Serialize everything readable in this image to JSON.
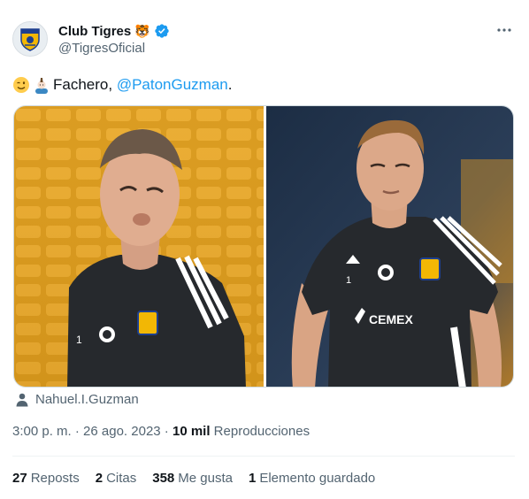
{
  "author": {
    "display_name": "Club Tigres",
    "name_badge_emoji": "🐯",
    "handle": "@TigresOficial",
    "verified": true
  },
  "tweet": {
    "text_prefix": "Fachero, ",
    "mention": "@PatonGuzman",
    "text_suffix": ".",
    "emojis": [
      "winking-face",
      "man-with-mohawk"
    ]
  },
  "media": {
    "left_photo_jersey": "1",
    "right_photo_sponsor": "CEMEX",
    "right_photo_jersey": "1"
  },
  "tagged_user": "Nahuel.I.Guzman",
  "meta": {
    "time": "3:00 p. m.",
    "separator": " · ",
    "date": "26 ago. 2023",
    "separator2": " · ",
    "views_count": "10 mil",
    "views_label": " Reproducciones"
  },
  "stats": [
    {
      "count": "27",
      "label": "Reposts"
    },
    {
      "count": "2",
      "label": "Citas"
    },
    {
      "count": "358",
      "label": "Me gusta"
    },
    {
      "count": "1",
      "label": "Elemento guardado"
    }
  ],
  "colors": {
    "accent": "#1d9bf0",
    "text": "#0f1419",
    "secondary": "#536471",
    "tigres_gold": "#f2b705",
    "tigres_navy": "#1d3f8f"
  }
}
